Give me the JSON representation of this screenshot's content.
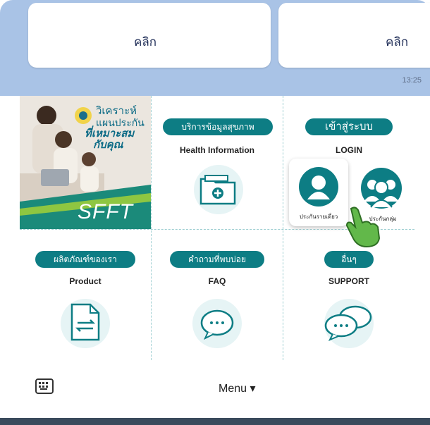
{
  "chat": {
    "bubble_left_text": "คลิก",
    "bubble_right_text": "คลิก",
    "time": "13:25"
  },
  "promo": {
    "title_line1": "วิเคราะห์",
    "title_line2": "แผนประกัน",
    "title_line3": "ที่เหมาะสม",
    "title_line4": "กับคุณ",
    "brand": "SFFT"
  },
  "tiles": {
    "health": {
      "pill": "บริการข้อมูลสุขภาพ",
      "label": "Health Information"
    },
    "login": {
      "pill": "เข้าสู่ระบบ",
      "label": "LOGIN",
      "option1": "ประกันรายเดี่ยว",
      "option2": "ประกันกลุ่ม"
    },
    "product": {
      "pill": "ผลิตภัณฑ์ของเรา",
      "label": "Product"
    },
    "faq": {
      "pill": "คำถามที่พบบ่อย",
      "label": "FAQ"
    },
    "support": {
      "pill": "อื่นๆ",
      "label": "SUPPORT"
    }
  },
  "menubar": {
    "menu_label": "Menu ▾"
  },
  "colors": {
    "accent": "#0d7d84",
    "band": "#a9c3e6",
    "promo_green": "#1b8a7a"
  }
}
